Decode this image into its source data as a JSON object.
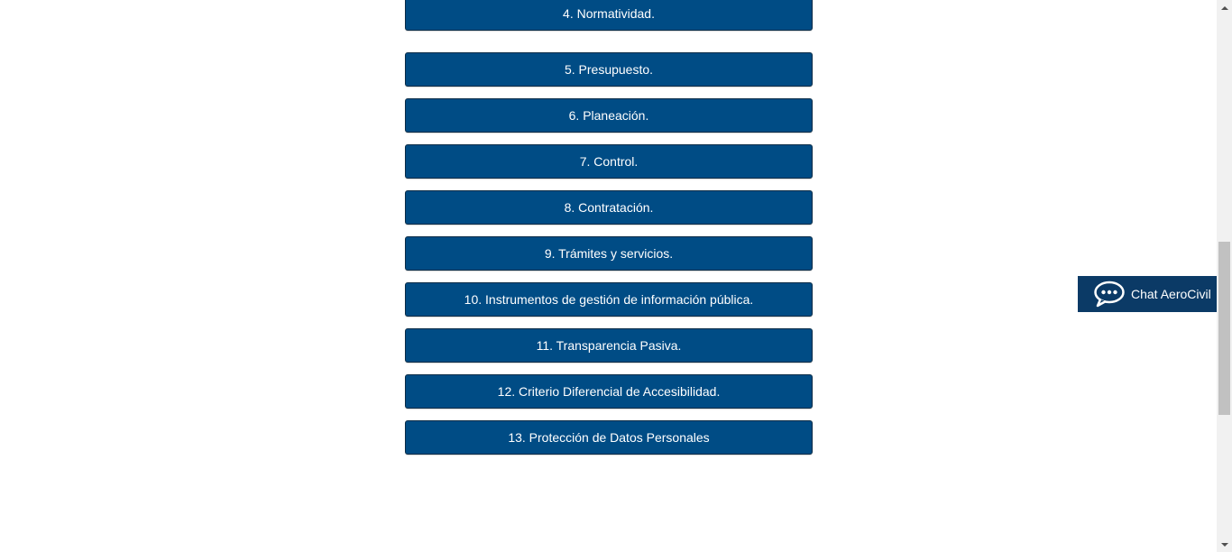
{
  "menu": {
    "items": [
      {
        "label": "4. Normatividad."
      },
      {
        "label": "5. Presupuesto."
      },
      {
        "label": "6. Planeación."
      },
      {
        "label": "7. Control."
      },
      {
        "label": "8. Contratación."
      },
      {
        "label": "9. Trámites y servicios."
      },
      {
        "label": "10. Instrumentos de gestión de información pública."
      },
      {
        "label": "11. Transparencia Pasiva."
      },
      {
        "label": "12. Criterio Diferencial de Accesibilidad."
      },
      {
        "label": "13. Protección de Datos Personales"
      }
    ]
  },
  "chat": {
    "label": "Chat AeroCivil",
    "icon": "chat-bubble-icon"
  },
  "colors": {
    "button_bg": "#004c85",
    "button_border": "#062a46",
    "chat_bg": "#0b3a66",
    "text": "#ffffff"
  }
}
